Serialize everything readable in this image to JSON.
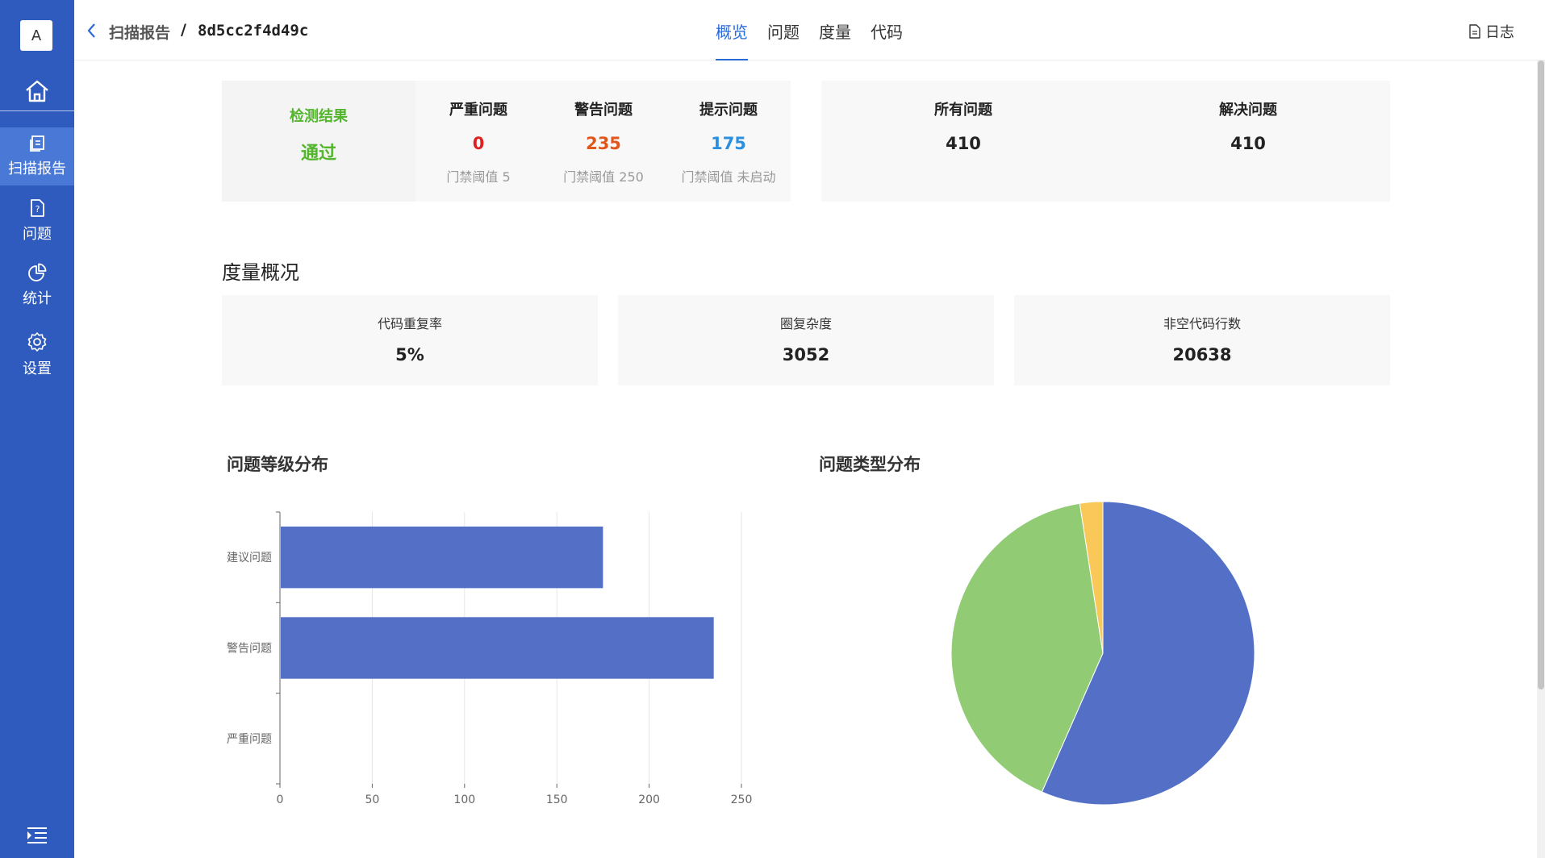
{
  "sidebar": {
    "avatar_letter": "A",
    "items": [
      {
        "label": "扫描报告",
        "icon": "report-icon",
        "active": true
      },
      {
        "label": "问题",
        "icon": "issue-file-icon",
        "active": false
      },
      {
        "label": "统计",
        "icon": "pie-chart-icon",
        "active": false
      },
      {
        "label": "设置",
        "icon": "gear-icon",
        "active": false
      }
    ]
  },
  "header": {
    "breadcrumb_parent": "扫描报告",
    "separator": "/",
    "scan_id": "8d5cc2f4d49c",
    "tabs": [
      {
        "label": "概览",
        "active": true
      },
      {
        "label": "问题",
        "active": false
      },
      {
        "label": "度量",
        "active": false
      },
      {
        "label": "代码",
        "active": false
      }
    ],
    "log_label": "日志"
  },
  "result": {
    "label": "检测结果",
    "value": "通过",
    "color": "#52b52b"
  },
  "issues": [
    {
      "label": "严重问题",
      "value": "0",
      "threshold": "门禁阈值 5",
      "color": "#e02020"
    },
    {
      "label": "警告问题",
      "value": "235",
      "threshold": "门禁阈值 250",
      "color": "#e0561b"
    },
    {
      "label": "提示问题",
      "value": "175",
      "threshold": "门禁阈值 未启动",
      "color": "#2b8fe0"
    }
  ],
  "summary": [
    {
      "label": "所有问题",
      "value": "410"
    },
    {
      "label": "解决问题",
      "value": "410"
    }
  ],
  "metrics_title": "度量概况",
  "metrics": [
    {
      "label": "代码重复率",
      "value": "5%"
    },
    {
      "label": "圈复杂度",
      "value": "3052"
    },
    {
      "label": "非空代码行数",
      "value": "20638"
    }
  ],
  "chart_data": [
    {
      "type": "bar",
      "title": "问题等级分布",
      "orientation": "horizontal",
      "categories": [
        "建议问题",
        "警告问题",
        "严重问题"
      ],
      "values": [
        175,
        235,
        0
      ],
      "xlim": [
        0,
        250
      ],
      "xticks": [
        0,
        50,
        100,
        150,
        200,
        250
      ],
      "grid": true,
      "color": "#5470c6"
    },
    {
      "type": "pie",
      "title": "问题类型分布",
      "values": [
        232,
        168,
        10
      ],
      "colors": [
        "#5470c6",
        "#91cc75",
        "#fac858"
      ]
    }
  ]
}
